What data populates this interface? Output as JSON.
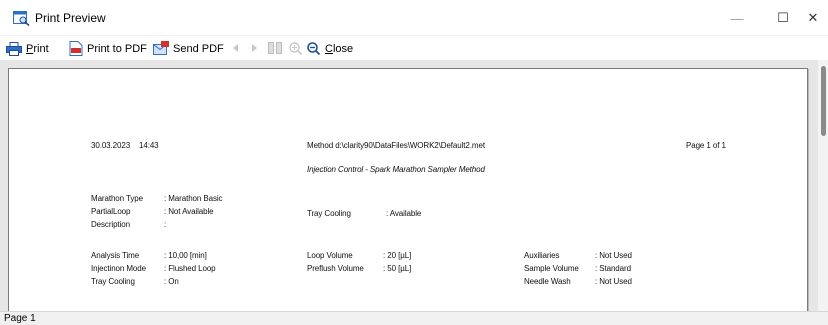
{
  "window": {
    "title": "Print Preview",
    "minimize_glyph": "—",
    "maximize_glyph": "☐",
    "close_glyph": "✕"
  },
  "toolbar": {
    "print_label_accel": "P",
    "print_label_rest": "rint",
    "print_pdf_label": "Print to PDF",
    "send_pdf_label": "Send PDF",
    "close_label_accel": "C",
    "close_label_rest": "lose",
    "icons": [
      "printer-icon",
      "pdf-icon",
      "send-pdf-icon",
      "prev-page-icon",
      "next-page-icon",
      "two-pages-icon",
      "zoom-in-icon",
      "zoom-out-icon"
    ]
  },
  "report": {
    "date": "30.03.2023",
    "time": "14:43",
    "method_line": "Method d:\\clarity90\\DataFiles\\WORK2\\Default2.met",
    "page_info": "Page 1 of 1",
    "subtitle": "Injection Control - Spark Marathon Sampler Method",
    "fields": {
      "marathon_type_label": "Marathon Type",
      "marathon_type_value": ": Marathon Basic",
      "partial_loop_label": "PartialLoop",
      "partial_loop_value": ": Not Available",
      "description_label": "Description",
      "description_value": ":",
      "tray_cooling_top_label": "Tray Cooling",
      "tray_cooling_top_value": ": Available",
      "analysis_time_label": "Analysis Time",
      "analysis_time_value": ": 10,00 [min]",
      "injection_mode_label": "Injectinon Mode",
      "injection_mode_value": ": Flushed Loop",
      "tray_cooling_label": "Tray Cooling",
      "tray_cooling_value": ": On",
      "loop_volume_label": "Loop Volume",
      "loop_volume_value": ": 20 [µL]",
      "preflush_volume_label": "Preflush Volume",
      "preflush_volume_value": ": 50 [µL]",
      "auxiliaries_label": "Auxiliaries",
      "auxiliaries_value": ": Not Used",
      "sample_volume_label": "Sample Volume",
      "sample_volume_value": ": Standard",
      "needle_wash_label": "Needle Wash",
      "needle_wash_value": ": Not Used"
    }
  },
  "status": {
    "page_label": "Page 1"
  },
  "colors": {
    "accent_blue": "#2b6fc7",
    "pdf_red": "#d0312d",
    "preview_bg": "#e6e6e6"
  }
}
